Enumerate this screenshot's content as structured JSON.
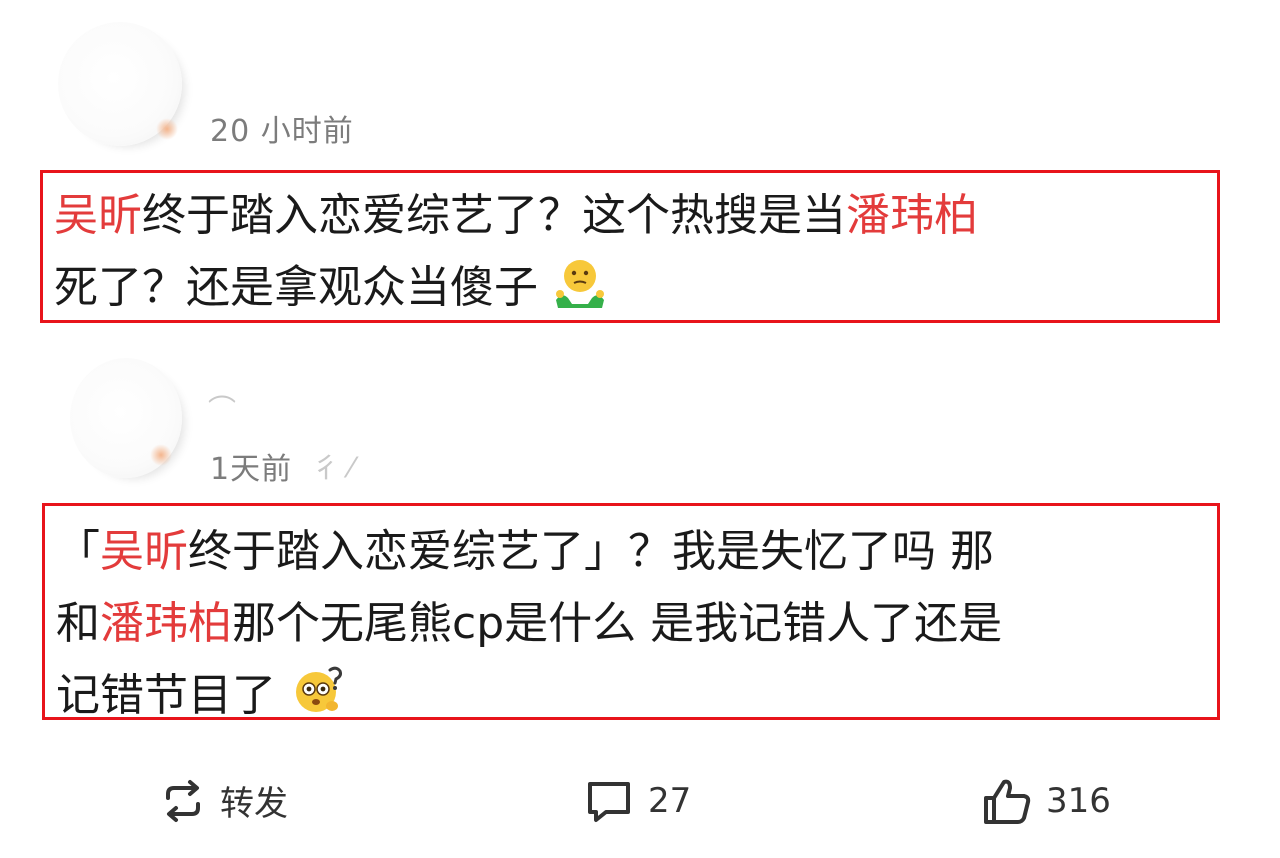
{
  "comments": [
    {
      "time": "20 小时前",
      "line1": [
        {
          "text": "吴昕",
          "hl": true
        },
        {
          "text": "终于踏入恋爱综艺了？这个热搜是当",
          "hl": false
        },
        {
          "text": "潘玮柏",
          "hl": true
        }
      ],
      "line2": [
        {
          "text": "死了？还是拿观众当傻子",
          "hl": false
        }
      ],
      "emoji": "shrug-emoji"
    },
    {
      "time": "1天前",
      "line1": [
        {
          "text": "「",
          "hl": false
        },
        {
          "text": "吴昕",
          "hl": true
        },
        {
          "text": "终于踏入恋爱综艺了」？我是失忆了吗 那",
          "hl": false
        }
      ],
      "line2": [
        {
          "text": "和",
          "hl": false
        },
        {
          "text": "潘玮柏",
          "hl": true
        },
        {
          "text": "那个无尾熊cp是什么 是我记错人了还是",
          "hl": false
        }
      ],
      "line3": [
        {
          "text": "记错节目了",
          "hl": false
        }
      ],
      "emoji": "confused-face-emoji"
    }
  ],
  "actions": {
    "repost_label": "转发",
    "comment_count": "27",
    "like_count": "316"
  },
  "colors": {
    "highlight": "#e33b3b",
    "box_border": "#e8141b",
    "meta": "#7c7c7c"
  }
}
